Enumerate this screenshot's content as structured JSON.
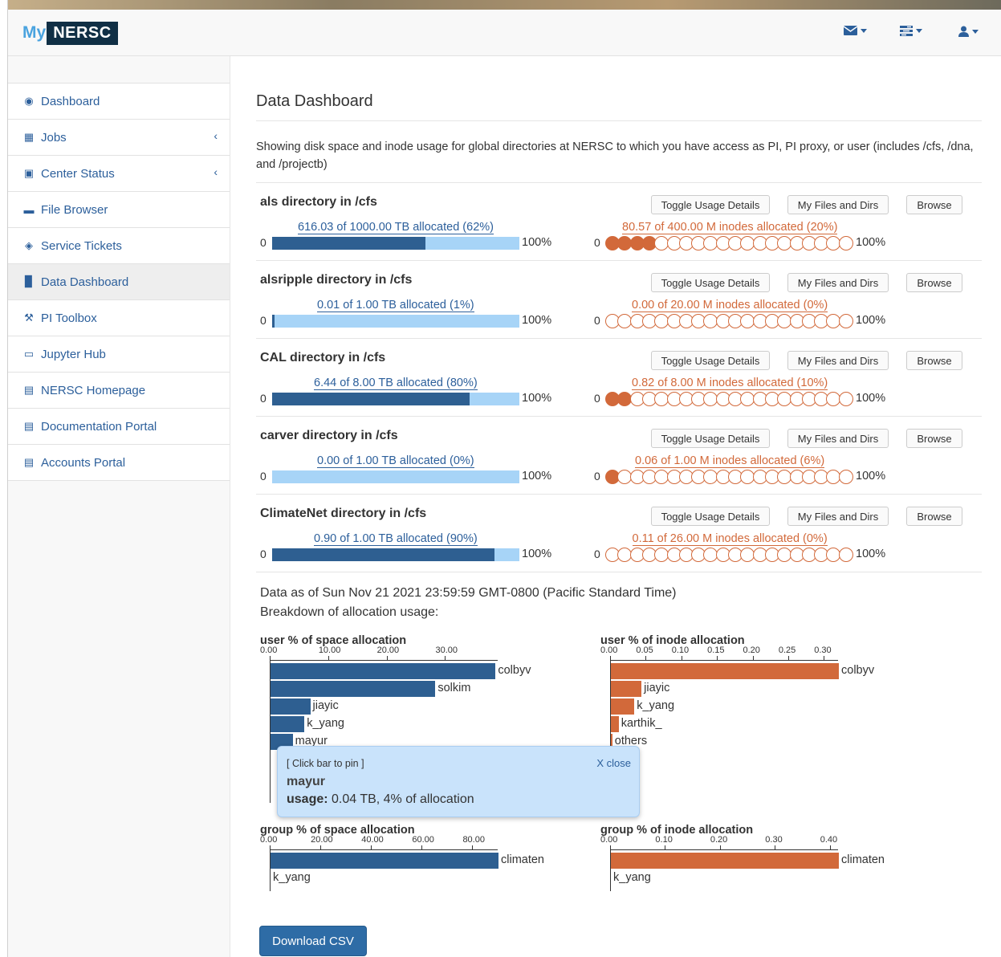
{
  "brand": {
    "my": "My",
    "nersc": "NERSC"
  },
  "nav_icons": [
    "envelope-icon",
    "tasks-icon",
    "user-icon"
  ],
  "sidebar": [
    {
      "label": "Dashboard",
      "icon": "tachometer-icon"
    },
    {
      "label": "Jobs",
      "icon": "table-icon",
      "chevron": "‹"
    },
    {
      "label": "Center Status",
      "icon": "hospital-icon",
      "chevron": "‹"
    },
    {
      "label": "File Browser",
      "icon": "folder-icon"
    },
    {
      "label": "Service Tickets",
      "icon": "ticket-icon"
    },
    {
      "label": "Data Dashboard",
      "icon": "bar-chart-icon",
      "active": true
    },
    {
      "label": "PI Toolbox",
      "icon": "wrench-icon"
    },
    {
      "label": "Jupyter Hub",
      "icon": "desktop-icon"
    },
    {
      "label": "NERSC Homepage",
      "icon": "newspaper-icon"
    },
    {
      "label": "Documentation Portal",
      "icon": "newspaper-icon"
    },
    {
      "label": "Accounts Portal",
      "icon": "newspaper-icon"
    }
  ],
  "page": {
    "title": "Data Dashboard",
    "intro": "Showing disk space and inode usage for global directories at NERSC to which you have access as PI, PI proxy, or user (includes /cfs, /dna, and /projectb)",
    "toggle_label": "Toggle Usage Details",
    "myfiles_label": "My Files and Dirs",
    "browse_label": "Browse",
    "zero": "0",
    "hundred": "100%",
    "as_of": "Data as of Sun Nov 21 2021 23:59:59 GMT-0800 (Pacific Standard Time)",
    "breakdown": "Breakdown of allocation usage:",
    "download": "Download CSV"
  },
  "directories": [
    {
      "name": "als directory in /cfs",
      "space_label": "616.03 of 1000.00 TB allocated (62%)",
      "space_fraction": 0.62,
      "inode_label": "80.57 of 400.00 M inodes allocated (20%)",
      "inode_filled": 4
    },
    {
      "name": "alsripple directory in /cfs",
      "space_label": "0.01 of 1.00 TB allocated (1%)",
      "space_fraction": 0.01,
      "inode_label": "0.00 of 20.00 M inodes allocated (0%)",
      "inode_filled": 0
    },
    {
      "name": "CAL directory in /cfs",
      "space_label": "6.44 of 8.00 TB allocated (80%)",
      "space_fraction": 0.8,
      "inode_label": "0.82 of 8.00 M inodes allocated (10%)",
      "inode_filled": 2
    },
    {
      "name": "carver directory in /cfs",
      "space_label": "0.00 of 1.00 TB allocated (0%)",
      "space_fraction": 0.0,
      "inode_label": "0.06 of 1.00 M inodes allocated (6%)",
      "inode_filled": 1
    },
    {
      "name": "ClimateNet directory in /cfs",
      "space_label": "0.90 of 1.00 TB allocated (90%)",
      "space_fraction": 0.9,
      "inode_label": "0.11 of 26.00 M inodes allocated (0%)",
      "inode_filled": 0
    }
  ],
  "inode_circle_count": 20,
  "colors": {
    "space": "#2e5f91",
    "space_bg": "#a7d4f7",
    "inode": "#d2693a",
    "link": "#2c5f9b"
  },
  "chart_data": [
    {
      "type": "bar",
      "title": "user % of space allocation",
      "ticks": [
        "0.00",
        "10.00",
        "20.00",
        "30.00"
      ],
      "xlim": [
        0,
        39
      ],
      "categories": [
        "colbyv",
        "solkim",
        "jiayic",
        "k_yang",
        "mayur"
      ],
      "values": [
        38.5,
        28.2,
        6.8,
        5.8,
        3.8
      ],
      "color": "#2e5f91"
    },
    {
      "type": "bar",
      "title": "user % of inode allocation",
      "ticks": [
        "0.00",
        "0.05",
        "0.10",
        "0.15",
        "0.20",
        "0.25",
        "0.30"
      ],
      "xlim": [
        0,
        0.32
      ],
      "categories": [
        "colbyv",
        "jiayic",
        "k_yang",
        "karthik_",
        "others"
      ],
      "values": [
        0.32,
        0.043,
        0.033,
        0.011,
        0.002
      ],
      "color": "#d2693a"
    },
    {
      "type": "bar",
      "title": "group % of space allocation",
      "ticks": [
        "0.00",
        "20.00",
        "40.00",
        "60.00",
        "80.00"
      ],
      "xlim": [
        0,
        90
      ],
      "categories": [
        "climaten",
        "k_yang"
      ],
      "values": [
        90,
        0
      ],
      "color": "#2e5f91"
    },
    {
      "type": "bar",
      "title": "group % of inode allocation",
      "ticks": [
        "0.00",
        "0.10",
        "0.20",
        "0.30",
        "0.40"
      ],
      "xlim": [
        0,
        0.415
      ],
      "categories": [
        "climaten",
        "k_yang"
      ],
      "values": [
        0.415,
        0
      ],
      "color": "#d2693a"
    }
  ],
  "tooltip": {
    "hint": "[ Click bar to pin ]",
    "close": "X close",
    "name": "mayur",
    "usage_label": "usage:",
    "usage_value": " 0.04 TB, 4% of allocation"
  }
}
